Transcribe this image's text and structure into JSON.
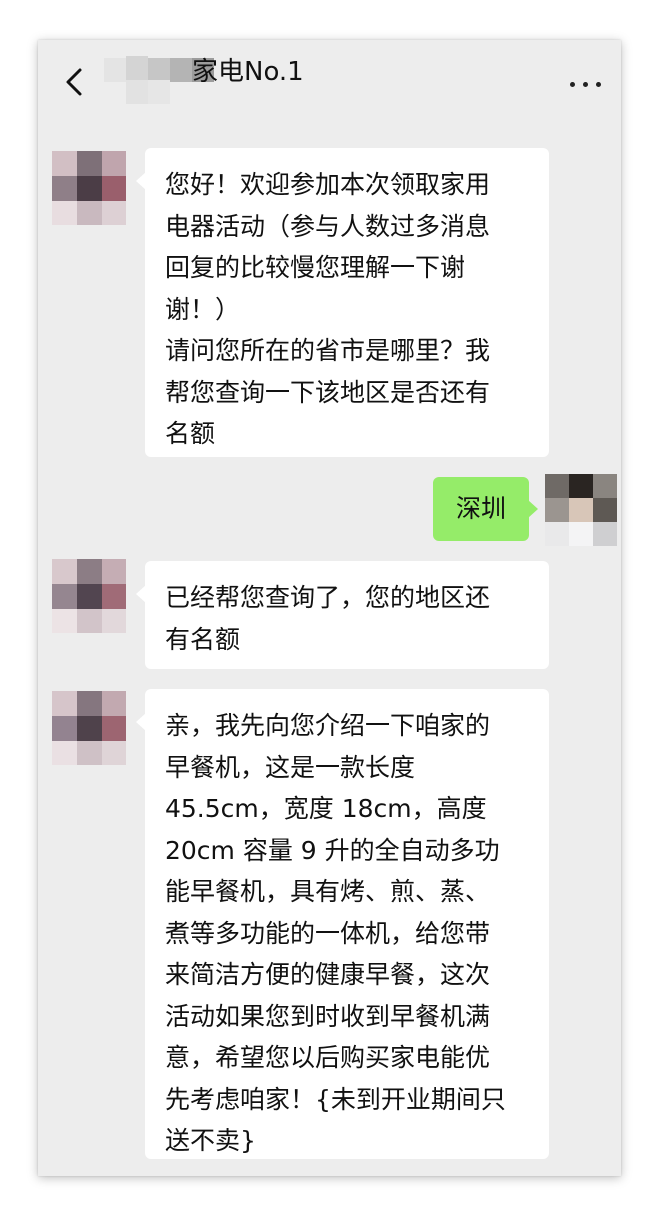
{
  "header": {
    "title": "家电No.1",
    "back_icon": "chevron-left-icon",
    "more_icon": "more-dots-icon"
  },
  "messages": [
    {
      "side": "left",
      "text": "您好！欢迎参加本次领取家用\n电器活动（参与人数过多消息\n回复的比较慢您理解一下谢\n谢！）\n请问您所在的省市是哪里？我\n帮您查询一下该地区是否还有\n名额"
    },
    {
      "side": "right",
      "text": "深圳"
    },
    {
      "side": "left",
      "text": "已经帮您查询了，您的地区还\n有名额"
    },
    {
      "side": "left",
      "text": "亲，我先向您介绍一下咱家的\n早餐机，这是一款长度\n45.5cm，宽度 18cm，高度\n20cm 容量 9 升的全自动多功\n能早餐机，具有烤、煎、蒸、\n煮等多功能的一体机，给您带\n来简洁方便的健康早餐，这次\n活动如果您到时收到早餐机满\n意，希望您以后购买家电能优\n先考虑咱家！{未到开业期间只\n送不卖}"
    }
  ],
  "colors": {
    "chat_background": "#ededed",
    "incoming_bubble": "#ffffff",
    "outgoing_bubble": "#95ec69",
    "text": "#111111"
  }
}
